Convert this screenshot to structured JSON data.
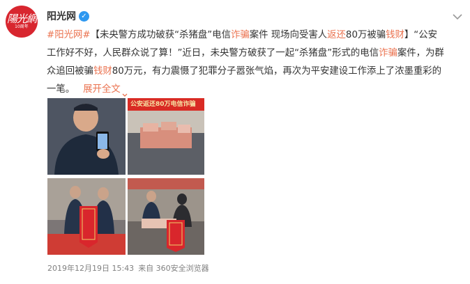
{
  "account": {
    "avatar_text": "陽光網",
    "avatar_sub": "10周年",
    "name": "阳光网"
  },
  "post": {
    "hashtag": "#阳光网#",
    "line1_a": "【未央警方成功破获“杀猪盘”电信",
    "line1_h1": "诈骗",
    "line1_b": "案件 现场向受害人",
    "line1_h2": "返还",
    "line1_c": "80万被骗",
    "line1_h3": "钱财",
    "line1_d": "】“公安",
    "line2": "工作好不好，人民群众说了算！”近日，未央警方破获了一起“杀猪盘”形式的电信",
    "line2_h": "诈骗",
    "line2_b": "案件，为群",
    "line3_a": "众追回被骗",
    "line3_h": "钱财",
    "line3_b": "80万元，有力震慑了犯罪分子嚣张气焰，再次为平安建设工作添上了浓墨重彩的",
    "line4": "一笔。",
    "expand_label": "展开全文"
  },
  "photos": {
    "banner_text": "公安返还80万电信诈骗"
  },
  "footer": {
    "timestamp": "2019年12月19日 15:43",
    "source": "来自 360安全浏览器"
  },
  "colors": {
    "accent": "#eb7350",
    "verified": "#2e98f0",
    "avatar": "#d8262f"
  },
  "icons": [
    "verified-badge-icon",
    "chevron-down-icon",
    "expand-chevron-icon"
  ]
}
